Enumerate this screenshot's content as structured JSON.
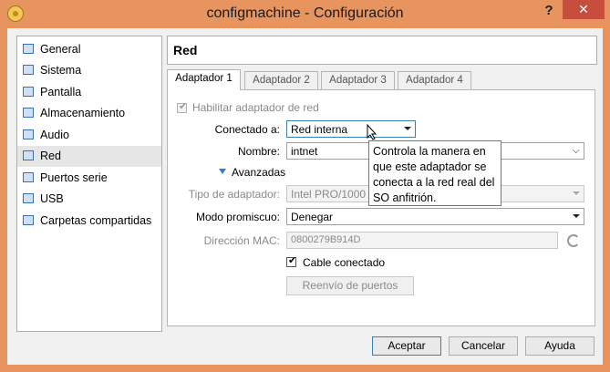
{
  "window": {
    "title": "configmachine - Configuración",
    "help_label": "?",
    "close_label": "✕"
  },
  "sidebar": {
    "items": [
      {
        "label": "General",
        "icon": "general-icon"
      },
      {
        "label": "Sistema",
        "icon": "system-icon"
      },
      {
        "label": "Pantalla",
        "icon": "display-icon"
      },
      {
        "label": "Almacenamiento",
        "icon": "storage-icon"
      },
      {
        "label": "Audio",
        "icon": "audio-icon"
      },
      {
        "label": "Red",
        "icon": "network-icon",
        "selected": true
      },
      {
        "label": "Puertos serie",
        "icon": "serial-ports-icon"
      },
      {
        "label": "USB",
        "icon": "usb-icon"
      },
      {
        "label": "Carpetas compartidas",
        "icon": "shared-folders-icon"
      }
    ]
  },
  "section": {
    "title": "Red"
  },
  "tabs": [
    {
      "label": "Adaptador 1",
      "active": true
    },
    {
      "label": "Adaptador 2"
    },
    {
      "label": "Adaptador 3"
    },
    {
      "label": "Adaptador 4"
    }
  ],
  "form": {
    "enable_adapter_label": "Habilitar adaptador de red",
    "enable_adapter_checked": true,
    "attached_to_label": "Conectado a:",
    "attached_to_value": "Red interna",
    "name_label": "Nombre:",
    "name_value": "intnet",
    "advanced_label": "Avanzadas",
    "adapter_type_label": "Tipo de adaptador:",
    "adapter_type_value": "Intel PRO/1000 MT",
    "promiscuous_label": "Modo promiscuo:",
    "promiscuous_value": "Denegar",
    "mac_label": "Dirección MAC:",
    "mac_value": "0800279B914D",
    "cable_label": "Cable conectado",
    "cable_checked": true,
    "port_forwarding_label": "Reenvío de puertos"
  },
  "tooltip": {
    "text": "Controla la manera en que este adaptador se conecta a la red real del SO anfitrión."
  },
  "buttons": {
    "accept": "Aceptar",
    "cancel": "Cancelar",
    "help": "Ayuda"
  },
  "colors": {
    "titlebar": "#e8945f",
    "close": "#c74e3d",
    "focus_border": "#3c7fb1"
  }
}
